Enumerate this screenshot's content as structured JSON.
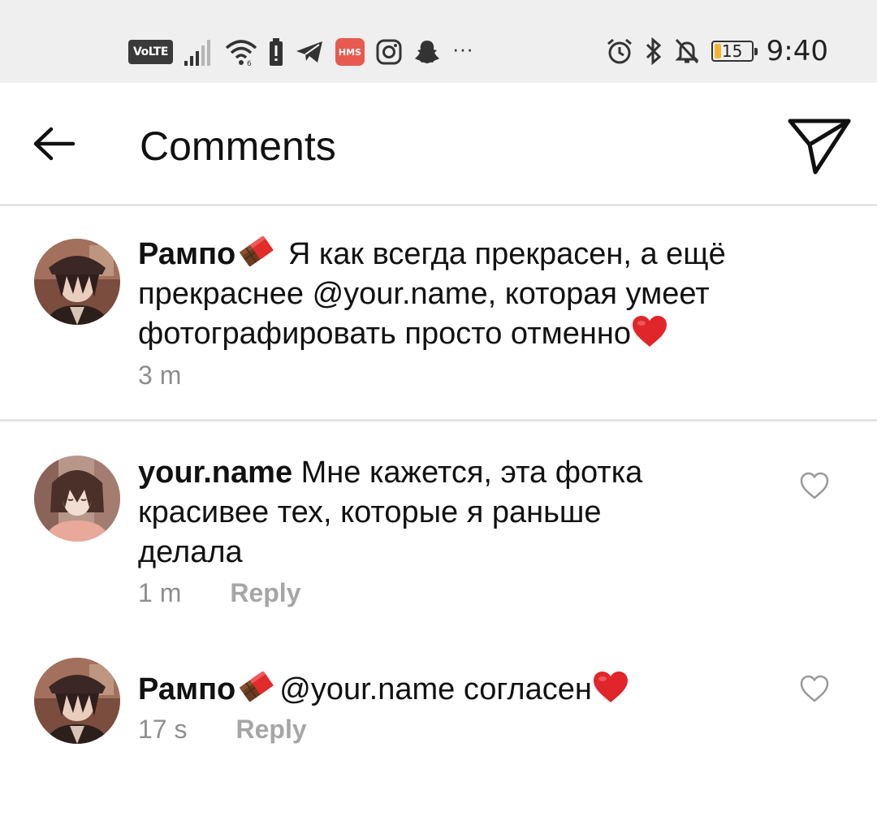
{
  "status_bar": {
    "volte_label": "VoLTE",
    "hms_label": "HMS",
    "battery_level": "15",
    "time": "9:40",
    "icons": [
      "signal-icon",
      "wifi-icon",
      "battery-saver-icon",
      "telegram-icon",
      "hms-icon",
      "instagram-icon",
      "snapchat-icon",
      "more-icon",
      "alarm-icon",
      "bluetooth-icon",
      "silent-icon",
      "battery-icon"
    ]
  },
  "header": {
    "title": "Comments",
    "back_icon": "arrow-left-icon",
    "send_icon": "direct-send-icon"
  },
  "caption": {
    "username": "Рампо",
    "username_emoji": "chocolate-icon",
    "text_before": " Я как всегда прекрасен, а ещё прекраснее ",
    "mention": "@your.name",
    "text_after": ", которая умеет фотографировать просто отменно",
    "end_emoji": "red-heart-icon",
    "time": "3 m"
  },
  "comments": [
    {
      "username": "your.name",
      "text": " Мне кажется, эта фотка красивее тех, которые я раньше делала",
      "time": "1 m",
      "reply_label": "Reply",
      "like_icon": "heart-outline-icon"
    },
    {
      "username": "Рампо",
      "username_emoji": "chocolate-icon",
      "mention": "@your.name",
      "text": " согласен",
      "end_emoji": "red-heart-icon",
      "time": "17 s",
      "reply_label": "Reply",
      "like_icon": "heart-outline-icon"
    }
  ],
  "colors": {
    "status_bar_bg": "#efefef",
    "divider": "#e4e4e4",
    "meta_text": "#8e8e8e",
    "reply_text": "#a6a6a6",
    "heart_red": "#e0262a",
    "battery_fill": "#f2b531"
  }
}
